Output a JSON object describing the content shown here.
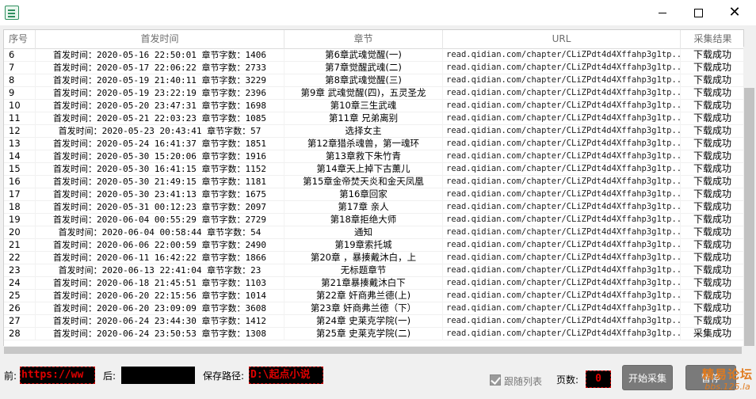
{
  "window": {
    "minimize_icon": "minimize-icon",
    "maximize_icon": "maximize-icon",
    "close_glyph": "✕"
  },
  "table": {
    "headers": [
      "序号",
      "首发时间",
      "章节",
      "URL",
      "采集结果"
    ],
    "rows": [
      {
        "idx": "6",
        "time": "首发时间：2020-05-16 22:50:01 章节字数：1406",
        "chapter": "第6章武魂觉醒(一)",
        "url": "read.qidian.com/chapter/CLiZPdt4d4Xffahp3g1tp...",
        "result": "下载成功"
      },
      {
        "idx": "7",
        "time": "首发时间：2020-05-17 22:06:22 章节字数：2733",
        "chapter": "第7章觉醒武魂(二)",
        "url": "read.qidian.com/chapter/CLiZPdt4d4Xffahp3g1tp...",
        "result": "下载成功"
      },
      {
        "idx": "8",
        "time": "首发时间：2020-05-19 21:40:11 章节字数：3229",
        "chapter": "第8章武魂觉醒(三)",
        "url": "read.qidian.com/chapter/CLiZPdt4d4Xffahp3g1tp...",
        "result": "下载成功"
      },
      {
        "idx": "9",
        "time": "首发时间：2020-05-19 23:22:19 章节字数：2396",
        "chapter": "第9章 武魂觉醒(四)，五灵圣龙",
        "url": "read.qidian.com/chapter/CLiZPdt4d4Xffahp3g1tp...",
        "result": "下载成功"
      },
      {
        "idx": "10",
        "time": "首发时间：2020-05-20 23:47:31 章节字数：1698",
        "chapter": "第10章三生武魂",
        "url": "read.qidian.com/chapter/CLiZPdt4d4Xffahp3g1tp...",
        "result": "下载成功"
      },
      {
        "idx": "11",
        "time": "首发时间：2020-05-21 22:03:23 章节字数：1085",
        "chapter": "第11章 兄弟离别",
        "url": "read.qidian.com/chapter/CLiZPdt4d4Xffahp3g1tp...",
        "result": "下载成功"
      },
      {
        "idx": "12",
        "time": "首发时间：2020-05-23 20:43:41 章节字数：57",
        "chapter": "选择女主",
        "url": "read.qidian.com/chapter/CLiZPdt4d4Xffahp3g1tp...",
        "result": "下载成功"
      },
      {
        "idx": "13",
        "time": "首发时间：2020-05-24 16:41:37 章节字数：1851",
        "chapter": "第12章猎杀魂兽，第一魂环",
        "url": "read.qidian.com/chapter/CLiZPdt4d4Xffahp3g1tp...",
        "result": "下载成功"
      },
      {
        "idx": "14",
        "time": "首发时间：2020-05-30 15:20:06 章节字数：1916",
        "chapter": "第13章救下朱竹青",
        "url": "read.qidian.com/chapter/CLiZPdt4d4Xffahp3g1tp...",
        "result": "下载成功"
      },
      {
        "idx": "15",
        "time": "首发时间：2020-05-30 16:41:15 章节字数：1152",
        "chapter": "第14章天上掉下古薰儿",
        "url": "read.qidian.com/chapter/CLiZPdt4d4Xffahp3g1tp...",
        "result": "下载成功"
      },
      {
        "idx": "16",
        "time": "首发时间：2020-05-30 21:49:15 章节字数：1181",
        "chapter": "第15章金帝焚天炎和金天凤凰",
        "url": "read.qidian.com/chapter/CLiZPdt4d4Xffahp3g1tp...",
        "result": "下载成功"
      },
      {
        "idx": "17",
        "time": "首发时间：2020-05-30 23:41:13 章节字数：1675",
        "chapter": "第16章回家",
        "url": "read.qidian.com/chapter/CLiZPdt4d4Xffahp3g1tp...",
        "result": "下载成功"
      },
      {
        "idx": "18",
        "time": "首发时间：2020-05-31 00:12:23 章节字数：2097",
        "chapter": "第17章 亲人",
        "url": "read.qidian.com/chapter/CLiZPdt4d4Xffahp3g1tp...",
        "result": "下载成功"
      },
      {
        "idx": "19",
        "time": "首发时间：2020-06-04 00:55:29 章节字数：2729",
        "chapter": "第18章拒绝大师",
        "url": "read.qidian.com/chapter/CLiZPdt4d4Xffahp3g1tp...",
        "result": "下载成功"
      },
      {
        "idx": "20",
        "time": "首发时间：2020-06-04 00:58:44 章节字数：54",
        "chapter": "通知",
        "url": "read.qidian.com/chapter/CLiZPdt4d4Xffahp3g1tp...",
        "result": "下载成功"
      },
      {
        "idx": "21",
        "time": "首发时间：2020-06-06 22:00:59 章节字数：2490",
        "chapter": "第19章索托城",
        "url": "read.qidian.com/chapter/CLiZPdt4d4Xffahp3g1tp...",
        "result": "下载成功"
      },
      {
        "idx": "22",
        "time": "首发时间：2020-06-11 16:42:22 章节字数：1866",
        "chapter": "第20章 ，暴揍戴沐白，上",
        "url": "read.qidian.com/chapter/CLiZPdt4d4Xffahp3g1tp...",
        "result": "下载成功"
      },
      {
        "idx": "23",
        "time": "首发时间：2020-06-13 22:41:04 章节字数：23",
        "chapter": "无标题章节",
        "url": "read.qidian.com/chapter/CLiZPdt4d4Xffahp3g1tp...",
        "result": "下载成功"
      },
      {
        "idx": "24",
        "time": "首发时间：2020-06-18 21:45:51 章节字数：1103",
        "chapter": "第21章暴揍戴沐白下",
        "url": "read.qidian.com/chapter/CLiZPdt4d4Xffahp3g1tp...",
        "result": "下载成功"
      },
      {
        "idx": "25",
        "time": "首发时间：2020-06-20 22:15:56 章节字数：1014",
        "chapter": "第22章 奸商弗兰德(上)",
        "url": "read.qidian.com/chapter/CLiZPdt4d4Xffahp3g1tp...",
        "result": "下载成功"
      },
      {
        "idx": "26",
        "time": "首发时间：2020-06-20 23:09:09 章节字数：3608",
        "chapter": "第23章 奸商弗兰德（下）",
        "url": "read.qidian.com/chapter/CLiZPdt4d4Xffahp3g1tp...",
        "result": "下载成功"
      },
      {
        "idx": "27",
        "time": "首发时间：2020-06-24 23:44:30 章节字数：1412",
        "chapter": "第24章 史莱克学院(一)",
        "url": "read.qidian.com/chapter/CLiZPdt4d4Xffahp3g1tp...",
        "result": "下载成功"
      },
      {
        "idx": "28",
        "time": "首发时间：2020-06-24 23:50:53 章节字数：1308",
        "chapter": "第25章 史莱克学院(二)",
        "url": "read.qidian.com/chapter/CLiZPdt4d4Xffahp3g1tp...",
        "result": "采集成功"
      }
    ]
  },
  "controls": {
    "prefix_label": "前:",
    "prefix_value": "https://ww",
    "suffix_label": "后:",
    "suffix_value": "",
    "path_label": "保存路径:",
    "path_value": "D:\\起点小说",
    "follow_list_label": "跟随列表",
    "follow_list_checked": true,
    "pages_label": "页数:",
    "pages_value": "0",
    "start_button": "开始采集",
    "pause_button": "暂停"
  },
  "watermark": {
    "line1": "精易论坛",
    "line2": "bbs.125.la"
  },
  "colors": {
    "field_bg": "#000000",
    "field_text": "#e00000",
    "button_bg": "#7a7a7a",
    "watermark": "#e07a1e"
  }
}
